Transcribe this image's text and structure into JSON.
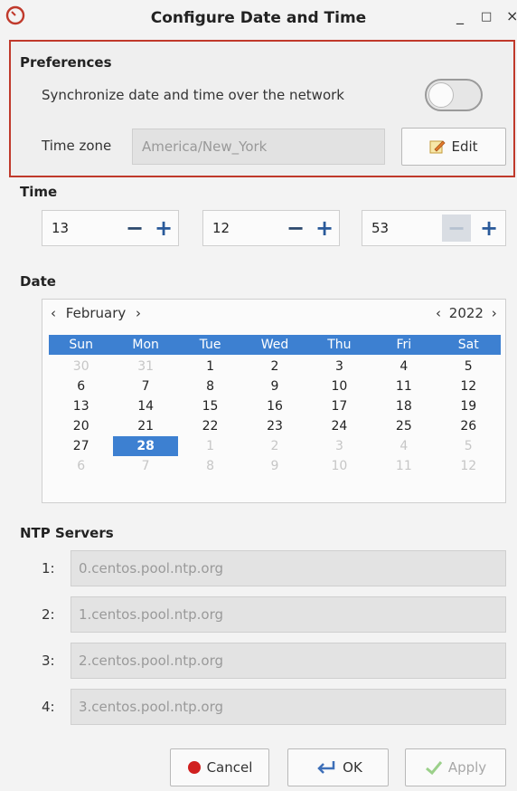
{
  "window": {
    "title": "Configure Date and Time",
    "minimize": "_",
    "maximize": "□",
    "close": "×"
  },
  "preferences": {
    "title": "Preferences",
    "sync_label": "Synchronize date and time over the network",
    "sync_enabled": false,
    "timezone_label": "Time zone",
    "timezone_value": "America/New_York",
    "edit_label": "Edit"
  },
  "time": {
    "title": "Time",
    "hour": "13",
    "minute": "12",
    "second": "53",
    "minus": "−",
    "plus": "+"
  },
  "date": {
    "title": "Date",
    "month": "February",
    "year": "2022",
    "prev": "‹",
    "next": "›",
    "weekdays": [
      "Sun",
      "Mon",
      "Tue",
      "Wed",
      "Thu",
      "Fri",
      "Sat"
    ],
    "weeks": [
      [
        "30",
        "31",
        "1",
        "2",
        "3",
        "4",
        "5"
      ],
      [
        "6",
        "7",
        "8",
        "9",
        "10",
        "11",
        "12"
      ],
      [
        "13",
        "14",
        "15",
        "16",
        "17",
        "18",
        "19"
      ],
      [
        "20",
        "21",
        "22",
        "23",
        "24",
        "25",
        "26"
      ],
      [
        "27",
        "28",
        "1",
        "2",
        "3",
        "4",
        "5"
      ],
      [
        "6",
        "7",
        "8",
        "9",
        "10",
        "11",
        "12"
      ]
    ],
    "selected_day": "28"
  },
  "ntp": {
    "title": "NTP Servers",
    "servers": [
      {
        "num": "1:",
        "value": "0.centos.pool.ntp.org"
      },
      {
        "num": "2:",
        "value": "1.centos.pool.ntp.org"
      },
      {
        "num": "3:",
        "value": "2.centos.pool.ntp.org"
      },
      {
        "num": "4:",
        "value": "3.centos.pool.ntp.org"
      }
    ]
  },
  "buttons": {
    "cancel": "Cancel",
    "ok": "OK",
    "apply": "Apply"
  },
  "colors": {
    "accent": "#3d80d1",
    "highlight_border": "#c0392b"
  }
}
